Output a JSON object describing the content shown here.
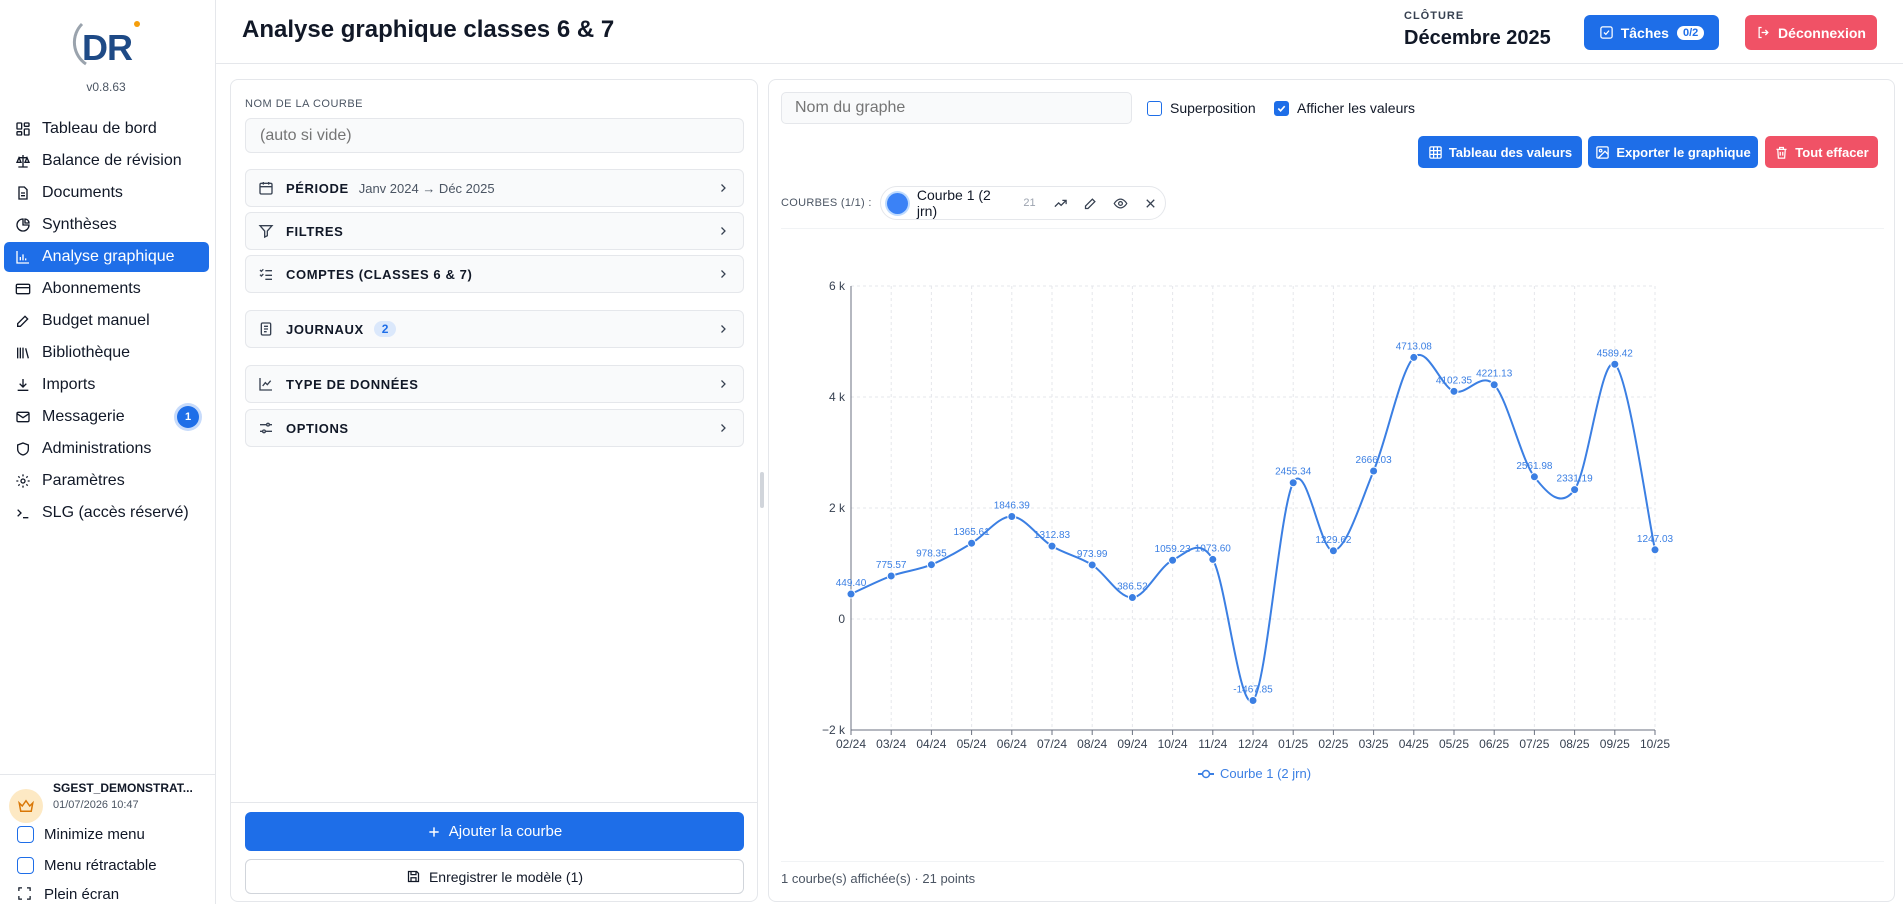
{
  "app": {
    "version": "v0.8.63",
    "logo_text": "DR"
  },
  "header": {
    "title": "Analyse graphique classes 6 & 7",
    "cloture_label": "CLÔTURE",
    "cloture_value": "Décembre 2025",
    "tasks_label": "Tâches",
    "tasks_count": "0/2",
    "logout_label": "Déconnexion"
  },
  "sidebar": {
    "items": [
      {
        "label": "Tableau de bord",
        "icon": "dashboard-icon"
      },
      {
        "label": "Balance de révision",
        "icon": "scale-icon"
      },
      {
        "label": "Documents",
        "icon": "document-icon"
      },
      {
        "label": "Synthèses",
        "icon": "pie-chart-icon"
      },
      {
        "label": "Analyse graphique",
        "icon": "bar-chart-icon",
        "active": true
      },
      {
        "label": "Abonnements",
        "icon": "credit-card-icon"
      },
      {
        "label": "Budget manuel",
        "icon": "pencil-icon"
      },
      {
        "label": "Bibliothèque",
        "icon": "library-icon"
      },
      {
        "label": "Imports",
        "icon": "download-icon"
      },
      {
        "label": "Messagerie",
        "icon": "mail-icon",
        "badge": "1"
      },
      {
        "label": "Administrations",
        "icon": "shield-icon"
      },
      {
        "label": "Paramètres",
        "icon": "gear-icon"
      },
      {
        "label": "SLG (accès réservé)",
        "icon": "terminal-icon"
      }
    ],
    "user_name": "SGEST_DEMONSTRAT...",
    "user_date": "01/07/2026 10:47",
    "minimize_label": "Minimize menu",
    "retractable_label": "Menu rétractable",
    "fullscreen_label": "Plein écran"
  },
  "config": {
    "curve_name_label": "NOM DE LA COURBE",
    "curve_name_placeholder": "(auto si vide)",
    "sections": {
      "periode": {
        "title": "PÉRIODE",
        "sub": "Janv 2024 → Déc 2025"
      },
      "filtres": {
        "title": "FILTRES"
      },
      "comptes": {
        "title": "COMPTES (CLASSES 6 & 7)"
      },
      "journaux": {
        "title": "JOURNAUX",
        "count": "2"
      },
      "type": {
        "title": "TYPE DE DONNÉES"
      },
      "options": {
        "title": "OPTIONS"
      }
    },
    "add_curve_label": "Ajouter la courbe",
    "save_model_label": "Enregistrer le modèle (1)"
  },
  "graph": {
    "name_placeholder": "Nom du graphe",
    "superposition_label": "Superposition",
    "show_values_label": "Afficher les valeurs",
    "show_values_checked": true,
    "superposition_checked": false,
    "table_btn": "Tableau des valeurs",
    "export_btn": "Exporter le graphique",
    "clear_btn": "Tout effacer",
    "courbes_label": "COURBES (1/1) :",
    "chip_name": "Courbe 1 (2 jrn)",
    "chip_count": "21",
    "status": "1 courbe(s) affichée(s) · 21 points",
    "colors": {
      "accent": "#1e6ee8",
      "danger": "#f05266",
      "series": "#3b7fe3"
    }
  },
  "chart_data": {
    "type": "line",
    "categories": [
      "02/24",
      "03/24",
      "04/24",
      "05/24",
      "06/24",
      "07/24",
      "08/24",
      "09/24",
      "10/24",
      "11/24",
      "12/24",
      "01/25",
      "02/25",
      "03/25",
      "04/25",
      "05/25",
      "06/25",
      "07/25",
      "08/25",
      "09/25",
      "10/25"
    ],
    "series": [
      {
        "name": "Courbe 1 (2 jrn)",
        "values": [
          449.4,
          775.57,
          978.35,
          1365.61,
          1846.39,
          1312.83,
          973.99,
          386.52,
          1059.23,
          1073.6,
          -1467.85,
          2455.34,
          1229.62,
          2666.03,
          4713.08,
          4102.35,
          4221.13,
          2561.98,
          2331.19,
          4589.42,
          1247.03
        ]
      }
    ],
    "value_labels": [
      "449.40",
      "775.57",
      "978.35",
      "1365.61",
      "1846.39",
      "1312.83",
      "973.99",
      "386.52",
      "1059.23",
      "1073.60",
      "-1467.85",
      "2455.34",
      "1229.62",
      "2666.03",
      "4713.08",
      "4102.35",
      "4221.13",
      "2561.98",
      "2331.19",
      "4589.42",
      "1247.03"
    ],
    "yticks": [
      {
        "v": 6000,
        "label": "6 k"
      },
      {
        "v": 4000,
        "label": "4 k"
      },
      {
        "v": 2000,
        "label": "2 k"
      },
      {
        "v": 0,
        "label": "0"
      },
      {
        "v": -2000,
        "label": "−2 k"
      }
    ],
    "ylim": [
      -2000,
      6000
    ],
    "grid": true,
    "legend": "bottom-center",
    "legend_label": "Courbe 1 (2 jrn)"
  }
}
